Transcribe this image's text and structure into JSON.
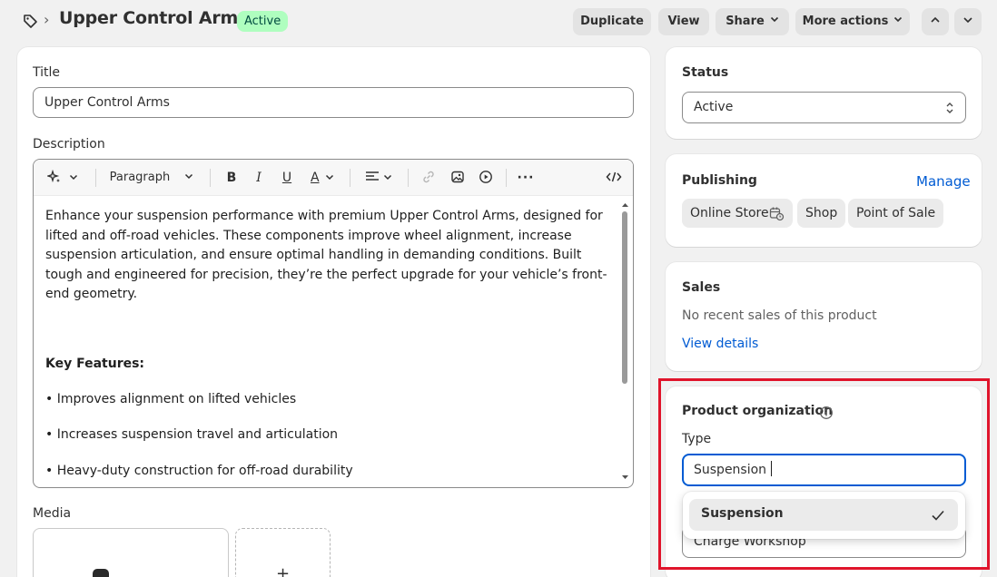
{
  "header": {
    "title": "Upper Control Arms",
    "status_badge": "Active",
    "buttons": {
      "duplicate": "Duplicate",
      "view": "View",
      "share": "Share",
      "more_actions": "More actions"
    },
    "icons": {
      "tag": "tag-icon",
      "breadcrumb_separator": "chevron-right-icon",
      "prev": "chevron-up-icon",
      "next": "chevron-down-icon"
    }
  },
  "main": {
    "title_label": "Title",
    "title_value": "Upper Control Arms",
    "description_label": "Description",
    "toolbar": {
      "paragraph": "Paragraph"
    },
    "description": {
      "paragraph1": "Enhance your suspension performance with premium Upper Control Arms, designed for lifted and off-road vehicles. These components improve wheel alignment, increase suspension articulation, and ensure optimal handling in demanding conditions. Built tough and engineered for precision, they’re the perfect upgrade for your vehicle’s front-end geometry.",
      "key_features_heading": "Key Features:",
      "features": [
        "• Improves alignment on lifted vehicles",
        "• Increases suspension travel and articulation",
        "• Heavy-duty construction for off-road durability"
      ]
    },
    "media_label": "Media",
    "media_add": "+"
  },
  "sidebar": {
    "status": {
      "heading": "Status",
      "value": "Active"
    },
    "publishing": {
      "heading": "Publishing",
      "manage": "Manage",
      "channels": [
        "Online Store",
        "Shop",
        "Point of Sale"
      ]
    },
    "sales": {
      "heading": "Sales",
      "text": "No recent sales of this product",
      "link": "View details"
    },
    "organization": {
      "heading": "Product organization",
      "type_label": "Type",
      "type_value": "Suspension",
      "dropdown_option": "Suspension",
      "next_field_value": "Charge Workshop"
    }
  },
  "colors": {
    "accent": "#005bd3",
    "badge_bg": "#affebf",
    "highlight": "#e0142b"
  }
}
